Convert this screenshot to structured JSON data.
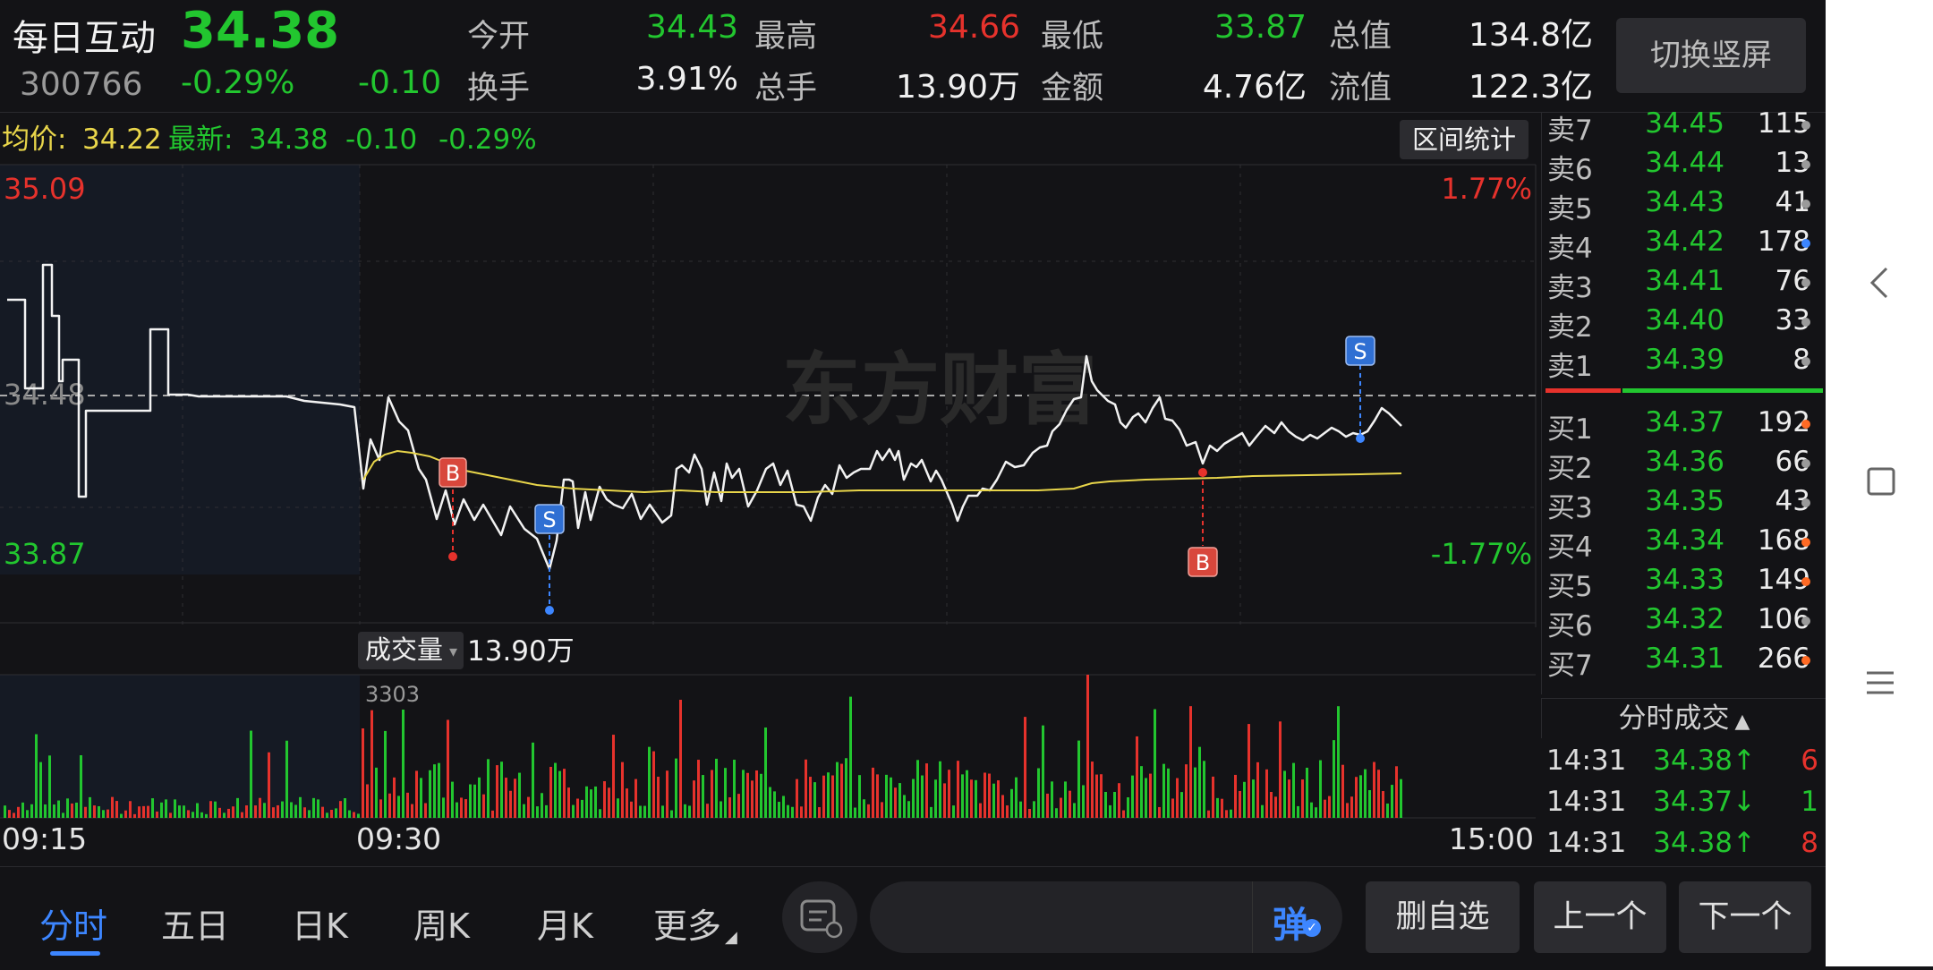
{
  "stock": {
    "name": "每日互动",
    "price": "34.38",
    "code": "300766",
    "change_pct": "-0.29%",
    "change": "-0.10",
    "stats": [
      {
        "label": "今开",
        "value": "34.43",
        "color": "green"
      },
      {
        "label": "最高",
        "value": "34.66",
        "color": "red"
      },
      {
        "label": "最低",
        "value": "33.87",
        "color": "green"
      },
      {
        "label": "总值",
        "value": "134.8亿",
        "color": "white"
      },
      {
        "label": "换手",
        "value": "3.91%",
        "color": "white"
      },
      {
        "label": "总手",
        "value": "13.90万",
        "color": "white"
      },
      {
        "label": "金额",
        "value": "4.76亿",
        "color": "white"
      },
      {
        "label": "流值",
        "value": "122.3亿",
        "color": "white"
      }
    ],
    "switch_button": "切换竖屏"
  },
  "chart_info": {
    "avg_label": "均价:",
    "avg_value": "34.22",
    "latest_label": "最新:",
    "latest_value": "34.38",
    "latest_change": "-0.10",
    "latest_pct": "-0.29%",
    "range_button": "区间统计",
    "price_high": "35.09",
    "price_low": "33.87",
    "price_mid": "34.48",
    "pct_high": "1.77%",
    "pct_low": "-1.77%",
    "watermark": "东方财富",
    "marker_b": "B",
    "marker_s": "S",
    "volume_label": "成交量",
    "volume_value": "13.90万",
    "volume_max": "3303",
    "time_labels": [
      "09:15",
      "09:30",
      "15:00"
    ]
  },
  "order_book": {
    "asks": [
      {
        "label": "卖7",
        "price": "34.45",
        "qty": "115",
        "dot": "gray"
      },
      {
        "label": "卖6",
        "price": "34.44",
        "qty": "13",
        "dot": "gray"
      },
      {
        "label": "卖5",
        "price": "34.43",
        "qty": "41",
        "dot": "gray"
      },
      {
        "label": "卖4",
        "price": "34.42",
        "qty": "178",
        "dot": "blue"
      },
      {
        "label": "卖3",
        "price": "34.41",
        "qty": "76",
        "dot": "gray"
      },
      {
        "label": "卖2",
        "price": "34.40",
        "qty": "33",
        "dot": "gray"
      },
      {
        "label": "卖1",
        "price": "34.39",
        "qty": "8",
        "dot": "gray"
      }
    ],
    "bids": [
      {
        "label": "买1",
        "price": "34.37",
        "qty": "192",
        "dot": "orange"
      },
      {
        "label": "买2",
        "price": "34.36",
        "qty": "66",
        "dot": "gray"
      },
      {
        "label": "买3",
        "price": "34.35",
        "qty": "43",
        "dot": "gray"
      },
      {
        "label": "买4",
        "price": "34.34",
        "qty": "168",
        "dot": "orange"
      },
      {
        "label": "买5",
        "price": "34.33",
        "qty": "149",
        "dot": "orange"
      },
      {
        "label": "买6",
        "price": "34.32",
        "qty": "106",
        "dot": "gray"
      },
      {
        "label": "买7",
        "price": "34.31",
        "qty": "266",
        "dot": "orange"
      }
    ],
    "trades_title": "分时成交",
    "trades": [
      {
        "time": "14:31",
        "price": "34.38↑",
        "qty": "6",
        "color": "green",
        "qcolor": "red"
      },
      {
        "time": "14:31",
        "price": "34.37↓",
        "qty": "1",
        "color": "green",
        "qcolor": "green"
      },
      {
        "time": "14:31",
        "price": "34.38↑",
        "qty": "8",
        "color": "green",
        "qcolor": "red"
      }
    ]
  },
  "bottom_tabs": [
    "分时",
    "五日",
    "日K",
    "周K",
    "月K",
    "更多"
  ],
  "bottom_buttons": {
    "danmaku": "弹",
    "remove": "删自选",
    "prev": "上一个",
    "next": "下一个"
  },
  "sysbar_icons": [
    "back-icon",
    "square-icon",
    "menu-icon"
  ]
}
